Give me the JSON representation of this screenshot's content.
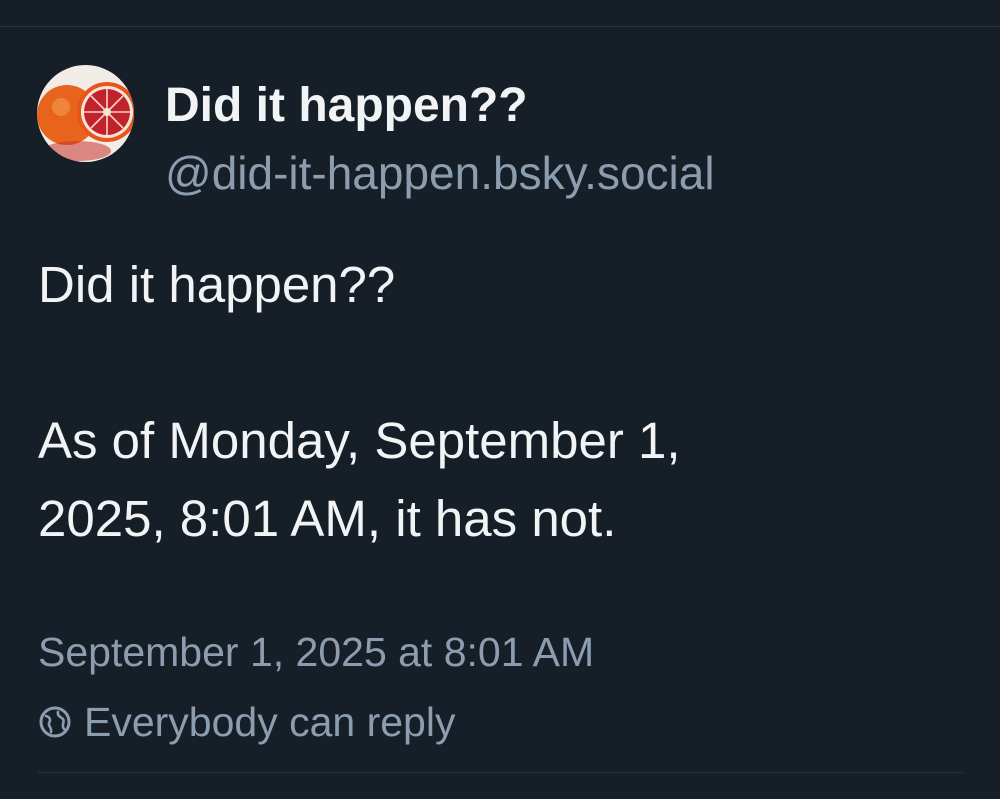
{
  "author": {
    "display_name": "Did it happen??",
    "handle": "@did-it-happen.bsky.social",
    "avatar_icon": "blood-orange-avatar"
  },
  "post": {
    "lines": [
      "Did it happen??",
      "",
      "As of Monday, September 1,",
      "2025, 8:01 AM, it has not."
    ],
    "timestamp": "September 1, 2025 at 8:01 AM",
    "reply_setting": "Everybody can reply",
    "reply_icon": "globe-icon"
  },
  "colors": {
    "background": "#161e27",
    "primary_text": "#f1f3f5",
    "secondary_text": "#8d9db0",
    "divider": "#2a3441"
  }
}
